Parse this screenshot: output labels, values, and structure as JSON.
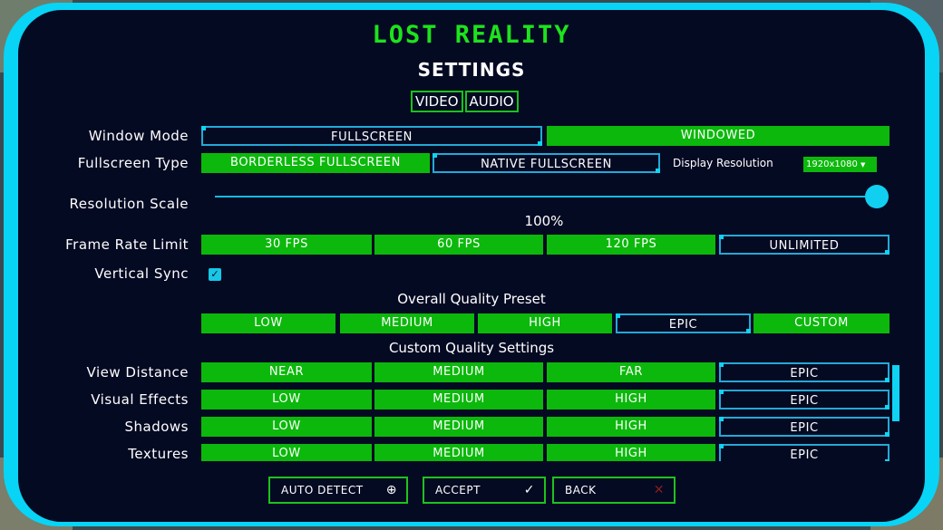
{
  "game_title": "LOST REALITY",
  "screen_title": "SETTINGS",
  "tabs": [
    "VIDEO",
    "AUDIO"
  ],
  "window_mode": {
    "label": "Window Mode",
    "options": [
      "FULLSCREEN",
      "WINDOWED"
    ],
    "selected": "FULLSCREEN"
  },
  "fullscreen_type": {
    "label": "Fullscreen Type",
    "options": [
      "BORDERLESS FULLSCREEN",
      "NATIVE FULLSCREEN"
    ],
    "selected": "NATIVE FULLSCREEN"
  },
  "display_resolution": {
    "label": "Display Resolution",
    "value": "1920x1080"
  },
  "resolution_scale": {
    "label": "Resolution Scale",
    "value_text": "100%",
    "value": 1.0
  },
  "frame_rate_limit": {
    "label": "Frame Rate Limit",
    "options": [
      "30 FPS",
      "60 FPS",
      "120 FPS",
      "UNLIMITED"
    ],
    "selected": "UNLIMITED"
  },
  "vertical_sync": {
    "label": "Vertical Sync",
    "checked": true
  },
  "overall_quality": {
    "heading": "Overall Quality Preset",
    "options": [
      "LOW",
      "MEDIUM",
      "HIGH",
      "EPIC",
      "CUSTOM"
    ],
    "selected": "EPIC"
  },
  "custom_quality": {
    "heading": "Custom Quality Settings",
    "rows": [
      {
        "label": "View Distance",
        "options": [
          "NEAR",
          "MEDIUM",
          "FAR",
          "EPIC"
        ],
        "selected": "EPIC"
      },
      {
        "label": "Visual Effects",
        "options": [
          "LOW",
          "MEDIUM",
          "HIGH",
          "EPIC"
        ],
        "selected": "EPIC"
      },
      {
        "label": "Shadows",
        "options": [
          "LOW",
          "MEDIUM",
          "HIGH",
          "EPIC"
        ],
        "selected": "EPIC"
      },
      {
        "label": "Textures",
        "options": [
          "LOW",
          "MEDIUM",
          "HIGH",
          "EPIC"
        ],
        "selected": "EPIC"
      }
    ]
  },
  "footer": {
    "auto_detect": "AUTO DETECT",
    "accept": "ACCEPT",
    "back": "BACK"
  },
  "colors": {
    "accent_green": "#0cb80c",
    "accent_cyan": "#08d4f6",
    "panel_bg": "#050a23"
  }
}
